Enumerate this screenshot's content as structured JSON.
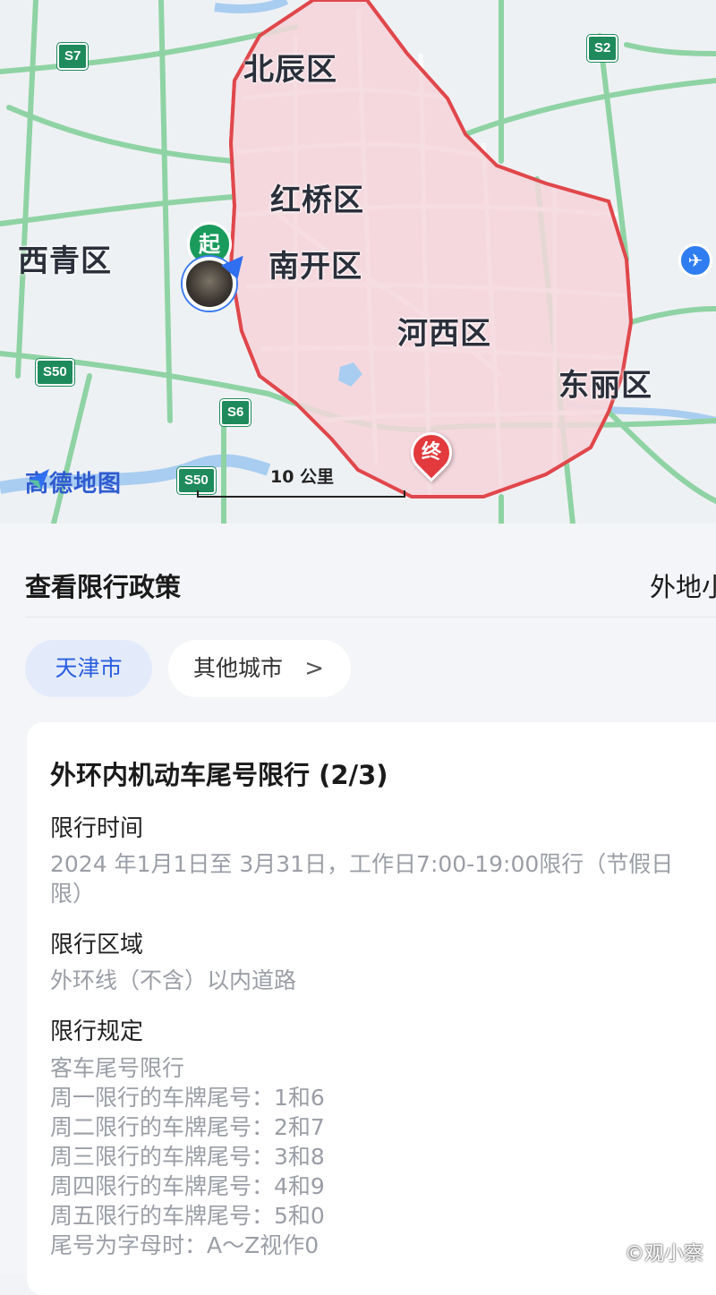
{
  "map": {
    "districts": {
      "beichen": "北辰区",
      "hongqiao": "红桥区",
      "nankai": "南开区",
      "xiqing": "西青区",
      "hexi": "河西区",
      "dongli": "东丽区"
    },
    "highways": {
      "s7": "S7",
      "s2": "S2",
      "s50_left": "S50",
      "s6": "S6",
      "s50_bottom": "S50"
    },
    "start_marker": "起",
    "end_marker": "终",
    "airport_icon": "plane-icon",
    "logo_text": "高德地图",
    "scale_label": "10 公里",
    "colors": {
      "restricted_fill": "#f4d7dd",
      "restricted_border": "#e0474b",
      "road_green": "#8fd3a4",
      "road_white": "#ffffff",
      "water": "#a9cdf0"
    }
  },
  "policy": {
    "header_title": "查看限行政策",
    "header_right": "外地小",
    "city_active": "天津市",
    "city_other": "其他城市",
    "chevron_icon": "chevron-right-icon",
    "card": {
      "title": "外环内机动车尾号限行 (2/3)",
      "time_label": "限行时间",
      "time_line1": "2024 年1月1日至 3月31日，工作日7:00-19:00限行（节假日",
      "time_line2": "限）",
      "area_label": "限行区域",
      "area_text": "外环线（不含）以内道路",
      "rule_label": "限行规定",
      "rules": [
        "客车尾号限行",
        "周一限行的车牌尾号：1和6",
        "周二限行的车牌尾号：2和7",
        "周三限行的车牌尾号：3和8",
        "周四限行的车牌尾号：4和9",
        "周五限行的车牌尾号：5和0",
        "尾号为字母时：A～Z视作0"
      ]
    },
    "watermark": "©观小察"
  }
}
